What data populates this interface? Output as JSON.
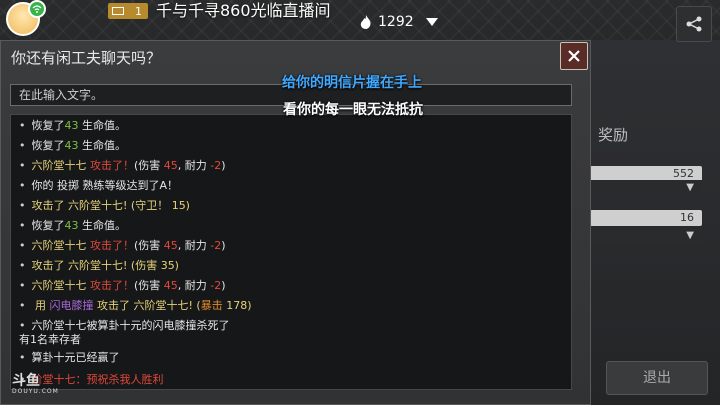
{
  "stream": {
    "level": "1",
    "title": "千与千寻860光临直播间",
    "hot_count": "1292"
  },
  "side": {
    "reward_label": "奖励",
    "field_value": "552",
    "select_value": "16",
    "exit_label": "退出"
  },
  "dialog": {
    "title": "你还有闲工夫聊天吗？",
    "input_placeholder": "在此输入文字。"
  },
  "captions": {
    "line1": "给你的明信片握在手上",
    "line2": "看你的每一眼无法抵抗"
  },
  "watermark": {
    "brand": "斗鱼",
    "domain": "DOUYU.COM"
  },
  "log": [
    {
      "segments": [
        {
          "t": "恢复了",
          "c": "w"
        },
        {
          "t": "43",
          "c": "g"
        },
        {
          "t": " 生命值。",
          "c": "w"
        }
      ]
    },
    {
      "segments": [
        {
          "t": "恢复了",
          "c": "w"
        },
        {
          "t": "43",
          "c": "g"
        },
        {
          "t": " 生命值。",
          "c": "w"
        }
      ]
    },
    {
      "segments": [
        {
          "t": "六阶堂十七  ",
          "c": "y"
        },
        {
          "t": "攻击了！",
          "c": "r"
        },
        {
          "t": "(伤害 ",
          "c": "w"
        },
        {
          "t": "45",
          "c": "r"
        },
        {
          "t": ",  耐力  ",
          "c": "w"
        },
        {
          "t": "-2",
          "c": "r"
        },
        {
          "t": ")",
          "c": "w"
        }
      ]
    },
    {
      "segments": [
        {
          "t": "你的 投掷 熟练等级达到了A！",
          "c": "w"
        }
      ]
    },
    {
      "segments": [
        {
          "t": "攻击了 六阶堂十七! (守卫！ 15)",
          "c": "y"
        }
      ]
    },
    {
      "segments": [
        {
          "t": "恢复了",
          "c": "w"
        },
        {
          "t": "43",
          "c": "g"
        },
        {
          "t": " 生命值。",
          "c": "w"
        }
      ]
    },
    {
      "segments": [
        {
          "t": "六阶堂十七  ",
          "c": "y"
        },
        {
          "t": "攻击了！",
          "c": "r"
        },
        {
          "t": "(伤害 ",
          "c": "w"
        },
        {
          "t": "45",
          "c": "r"
        },
        {
          "t": ",  耐力  ",
          "c": "w"
        },
        {
          "t": "-2",
          "c": "r"
        },
        {
          "t": ")",
          "c": "w"
        }
      ]
    },
    {
      "segments": [
        {
          "t": "攻击了 六阶堂十七! (伤害 35)",
          "c": "y"
        }
      ]
    },
    {
      "segments": [
        {
          "t": "六阶堂十七  ",
          "c": "y"
        },
        {
          "t": "攻击了！",
          "c": "r"
        },
        {
          "t": "(伤害 ",
          "c": "w"
        },
        {
          "t": "45",
          "c": "r"
        },
        {
          "t": ",  耐力  ",
          "c": "w"
        },
        {
          "t": "-2",
          "c": "r"
        },
        {
          "t": ")",
          "c": "w"
        }
      ]
    },
    {
      "segments": [
        {
          "t": " 用 ",
          "c": "y"
        },
        {
          "t": "闪电膝撞",
          "c": "p"
        },
        {
          "t": " 攻击了  六阶堂十七! (",
          "c": "y"
        },
        {
          "t": "暴击",
          "c": "o"
        },
        {
          "t": " 178)",
          "c": "y"
        }
      ]
    },
    {
      "segments": [
        {
          "t": "六阶堂十七被算卦十元的闪电膝撞杀死了",
          "c": "w"
        }
      ],
      "extra": "有1名幸存者"
    },
    {
      "segments": [
        {
          "t": "算卦十元已经赢了",
          "c": "w"
        }
      ]
    },
    {
      "segments": [
        {
          "t": "阶堂十七：预祝杀我人胜利",
          "c": "r"
        }
      ]
    }
  ]
}
